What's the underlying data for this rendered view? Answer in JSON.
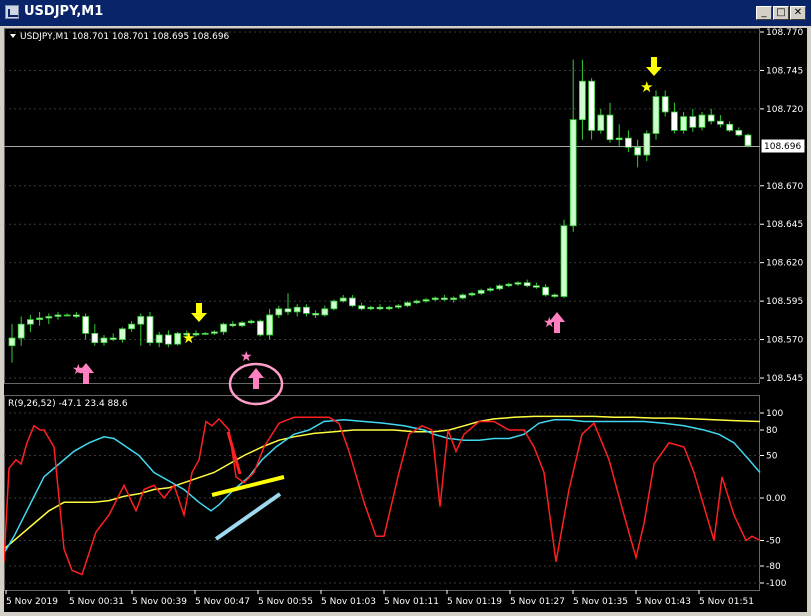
{
  "window": {
    "title": "USDJPY,M1",
    "buttons": {
      "minimize": "_",
      "maximize": "□",
      "close": "✕"
    }
  },
  "main_chart": {
    "info_label": "USDJPY,M1  108.701 108.701 108.695 108.696",
    "current_price_label": "108.696",
    "price_axis": [
      "108.770",
      "108.745",
      "108.720",
      "108.696",
      "108.670",
      "108.645",
      "108.620",
      "108.595",
      "108.570",
      "108.545"
    ],
    "colors": {
      "bull": "#ccffcc",
      "bear": "#ffffff",
      "wick": "#33cc33",
      "background": "#000000"
    }
  },
  "indicator": {
    "label": "R(9,26,52) -47.1 23.4 88.6",
    "axis": [
      "100",
      "80",
      "50",
      "0.00",
      "-50",
      "-80",
      "-100"
    ],
    "series_colors": {
      "fast": "#ff2020",
      "mid": "#40d8f0",
      "slow": "#ffff40"
    }
  },
  "time_axis": [
    "5 Nov 2019",
    "5 Nov 00:31",
    "5 Nov 00:39",
    "5 Nov 00:47",
    "5 Nov 00:55",
    "5 Nov 01:03",
    "5 Nov 01:11",
    "5 Nov 01:19",
    "5 Nov 01:27",
    "5 Nov 01:35",
    "5 Nov 01:43",
    "5 Nov 01:51"
  ],
  "annotations": {
    "up_arrows_color": "#ff80c0",
    "down_arrows_color": "#ffff00",
    "star_pink": "#ff80c0",
    "star_yellow": "#ffff00",
    "circle_color": "#ff9ec8",
    "yellow_line_color": "#ffff00",
    "blue_line_color": "#a0d8f0"
  },
  "chart_data": {
    "type": "candlestick",
    "title": "USDJPY,M1",
    "ylim": [
      108.545,
      108.77
    ],
    "candles": [
      [
        108.566,
        108.58,
        108.555,
        108.571
      ],
      [
        108.571,
        108.585,
        108.566,
        108.58
      ],
      [
        108.58,
        108.586,
        108.575,
        108.583
      ],
      [
        108.583,
        108.588,
        108.579,
        108.584
      ],
      [
        108.584,
        108.587,
        108.58,
        108.585
      ],
      [
        108.585,
        108.588,
        108.583,
        108.586
      ],
      [
        108.586,
        108.587,
        108.585,
        108.586
      ],
      [
        108.586,
        108.588,
        108.584,
        108.585
      ],
      [
        108.585,
        108.587,
        108.57,
        108.574
      ],
      [
        108.574,
        108.58,
        108.566,
        108.568
      ],
      [
        108.568,
        108.573,
        108.566,
        108.571
      ],
      [
        108.571,
        108.574,
        108.569,
        108.57
      ],
      [
        108.57,
        108.578,
        108.568,
        108.577
      ],
      [
        108.577,
        108.582,
        108.575,
        108.58
      ],
      [
        108.58,
        108.587,
        108.566,
        108.585
      ],
      [
        108.585,
        108.588,
        108.566,
        108.568
      ],
      [
        108.568,
        108.575,
        108.565,
        108.573
      ],
      [
        108.573,
        108.576,
        108.565,
        108.567
      ],
      [
        108.567,
        108.575,
        108.566,
        108.574
      ],
      [
        108.574,
        108.576,
        108.572,
        108.573
      ],
      [
        108.573,
        108.576,
        108.572,
        108.574
      ],
      [
        108.574,
        108.575,
        108.573,
        108.574
      ],
      [
        108.574,
        108.576,
        108.573,
        108.575
      ],
      [
        108.575,
        108.581,
        108.573,
        108.58
      ],
      [
        108.58,
        108.582,
        108.578,
        108.579
      ],
      [
        108.579,
        108.582,
        108.578,
        108.581
      ],
      [
        108.581,
        108.583,
        108.58,
        108.582
      ],
      [
        108.582,
        108.583,
        108.572,
        108.573
      ],
      [
        108.573,
        108.59,
        108.57,
        108.586
      ],
      [
        108.586,
        108.592,
        108.584,
        108.59
      ],
      [
        108.59,
        108.6,
        108.586,
        108.588
      ],
      [
        108.588,
        108.593,
        108.585,
        108.591
      ],
      [
        108.591,
        108.593,
        108.585,
        108.587
      ],
      [
        108.587,
        108.589,
        108.584,
        108.586
      ],
      [
        108.586,
        108.592,
        108.585,
        108.59
      ],
      [
        108.59,
        108.596,
        108.589,
        108.595
      ],
      [
        108.595,
        108.599,
        108.594,
        108.597
      ],
      [
        108.597,
        108.599,
        108.591,
        108.592
      ],
      [
        108.592,
        108.594,
        108.589,
        108.59
      ],
      [
        108.59,
        108.592,
        108.589,
        108.591
      ],
      [
        108.591,
        108.593,
        108.589,
        108.59
      ],
      [
        108.59,
        108.592,
        108.589,
        108.591
      ],
      [
        108.591,
        108.593,
        108.59,
        108.592
      ],
      [
        108.592,
        108.595,
        108.591,
        108.594
      ],
      [
        108.594,
        108.596,
        108.593,
        108.595
      ],
      [
        108.595,
        108.597,
        108.594,
        108.596
      ],
      [
        108.596,
        108.598,
        108.595,
        108.597
      ],
      [
        108.597,
        108.599,
        108.595,
        108.596
      ],
      [
        108.596,
        108.598,
        108.594,
        108.597
      ],
      [
        108.597,
        108.6,
        108.596,
        108.599
      ],
      [
        108.599,
        108.601,
        108.598,
        108.6
      ],
      [
        108.6,
        108.603,
        108.599,
        108.602
      ],
      [
        108.602,
        108.604,
        108.601,
        108.603
      ],
      [
        108.603,
        108.606,
        108.602,
        108.605
      ],
      [
        108.605,
        108.607,
        108.604,
        108.606
      ],
      [
        108.606,
        108.608,
        108.605,
        108.607
      ],
      [
        108.607,
        108.609,
        108.604,
        108.605
      ],
      [
        108.605,
        108.607,
        108.603,
        108.604
      ],
      [
        108.604,
        108.606,
        108.598,
        108.599
      ],
      [
        108.599,
        108.6,
        108.597,
        108.598
      ],
      [
        108.598,
        108.648,
        108.597,
        108.644
      ],
      [
        108.644,
        108.752,
        108.64,
        108.713
      ],
      [
        108.713,
        108.752,
        108.7,
        108.738
      ],
      [
        108.738,
        108.74,
        108.7,
        108.706
      ],
      [
        108.706,
        108.72,
        108.704,
        108.716
      ],
      [
        108.716,
        108.724,
        108.698,
        108.7
      ],
      [
        108.7,
        108.71,
        108.695,
        108.701
      ],
      [
        108.701,
        108.706,
        108.692,
        108.695
      ],
      [
        108.695,
        108.7,
        108.682,
        108.69
      ],
      [
        108.69,
        108.706,
        108.686,
        108.704
      ],
      [
        108.704,
        108.732,
        108.7,
        108.728
      ],
      [
        108.728,
        108.732,
        108.715,
        108.718
      ],
      [
        108.718,
        108.724,
        108.704,
        108.706
      ],
      [
        108.706,
        108.718,
        108.704,
        108.715
      ],
      [
        108.715,
        108.72,
        108.705,
        108.708
      ],
      [
        108.708,
        108.718,
        108.706,
        108.716
      ],
      [
        108.716,
        108.72,
        108.71,
        108.712
      ],
      [
        108.712,
        108.716,
        108.708,
        108.71
      ],
      [
        108.71,
        108.712,
        108.705,
        108.706
      ],
      [
        108.706,
        108.708,
        108.702,
        108.703
      ],
      [
        108.703,
        108.704,
        108.695,
        108.696
      ]
    ]
  }
}
